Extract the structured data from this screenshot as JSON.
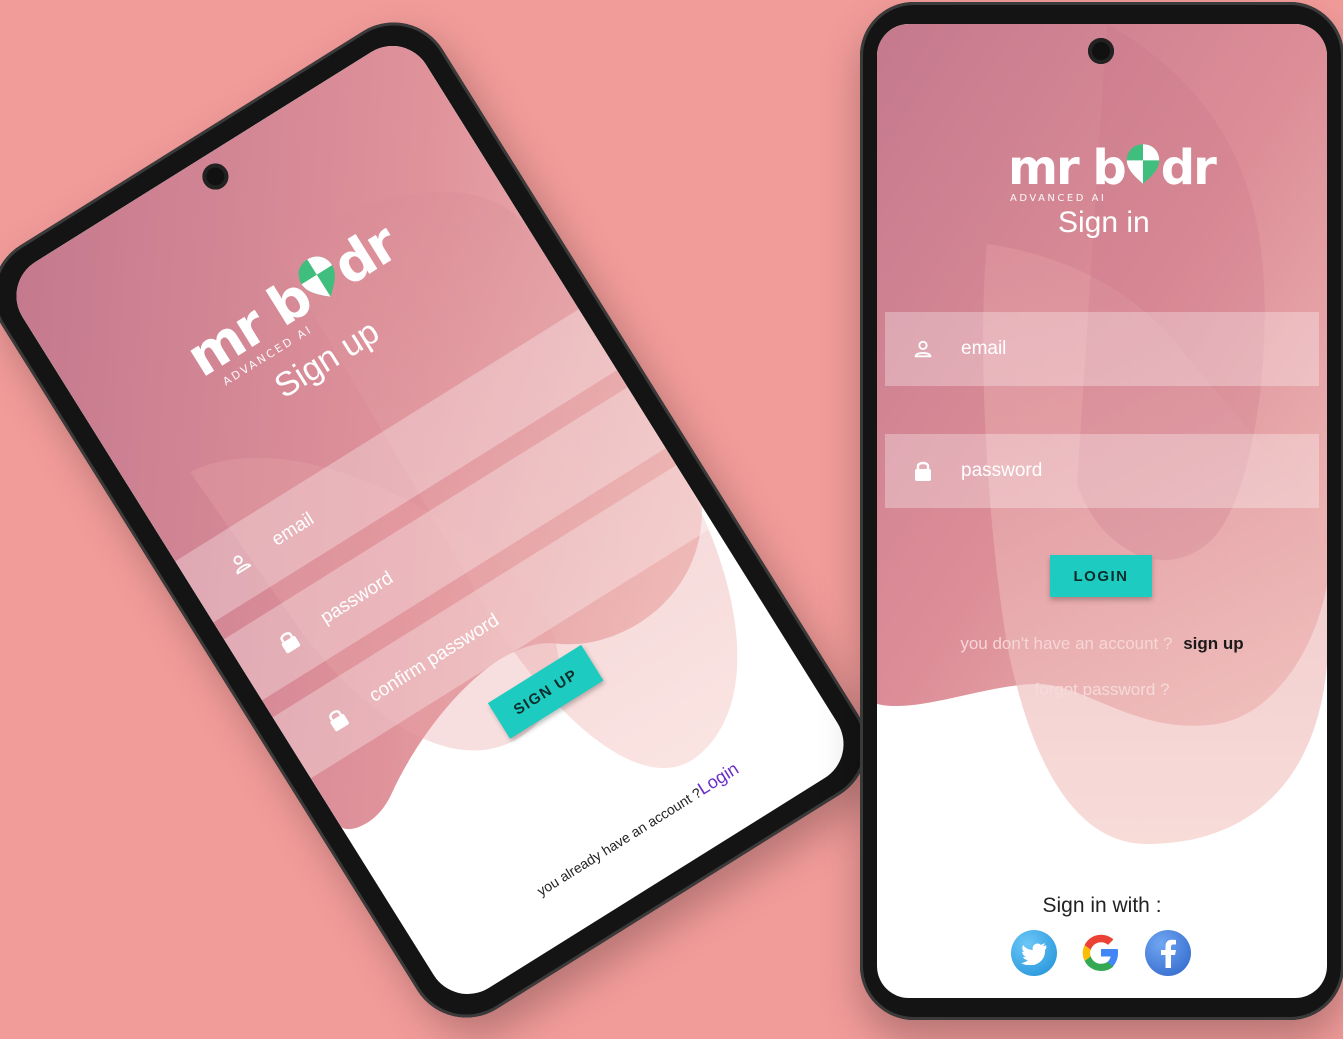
{
  "brand": {
    "word_left": "mr b",
    "word_right": "dr",
    "tagline": "ADVANCED AI"
  },
  "signup": {
    "title": "Sign up",
    "email_placeholder": "email",
    "password_placeholder": "password",
    "confirm_placeholder": "confirm password",
    "button_label": "SIGN UP",
    "footer_text": "you already have an account ?",
    "footer_link": "Login"
  },
  "signin": {
    "title": "Sign in",
    "email_placeholder": "email",
    "password_placeholder": "password",
    "button_label": "LOGIN",
    "no_account_text": "you don't have an account ?",
    "signup_link": "sign up",
    "forgot_link": "forgot password ?",
    "social_title": "Sign in with :",
    "social": [
      "twitter-icon",
      "google-icon",
      "facebook-icon"
    ]
  },
  "colors": {
    "background": "#f29c9a",
    "accent": "#1ecbc0",
    "gradient_top": "#c77b8c",
    "gradient_bottom": "#f3c4c0",
    "link_purple": "#6a2fc9"
  }
}
